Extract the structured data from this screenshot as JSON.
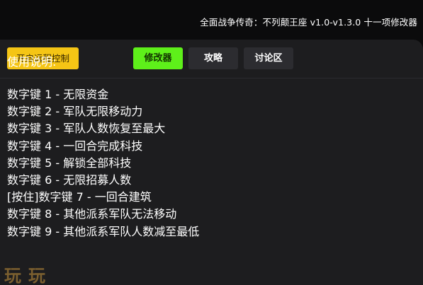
{
  "window": {
    "title": "全面战争传奇：不列颠王座 v1.0-v1.3.0 十一项修改器"
  },
  "toolbar": {
    "remote_control_label": "开启远程控制",
    "tabs": [
      {
        "label": "修改器",
        "active": true
      },
      {
        "label": "攻略",
        "active": false
      },
      {
        "label": "讨论区",
        "active": false
      }
    ]
  },
  "content": {
    "heading": "使用说明:",
    "hotkeys": [
      "数字键 1 - 无限资金",
      "数字键 2 - 军队无限移动力",
      "数字键 3 - 军队人数恢复至最大",
      "数字键 4 - 一回合完成科技",
      "数字键 5 - 解锁全部科技",
      "数字键 6 - 无限招募人数",
      "[按住]数字键 7 - 一回合建筑",
      "数字键 8 - 其他派系军队无法移动",
      "数字键 9 - 其他派系军队人数减至最低"
    ]
  },
  "watermark": {
    "text": "玩玩"
  },
  "colors": {
    "background": "#0b0b0c",
    "panel": "#1d1d1f",
    "remote_button": "#f5c515",
    "active_tab": "#5ef01a",
    "inactive_tab": "#2c2c30"
  }
}
